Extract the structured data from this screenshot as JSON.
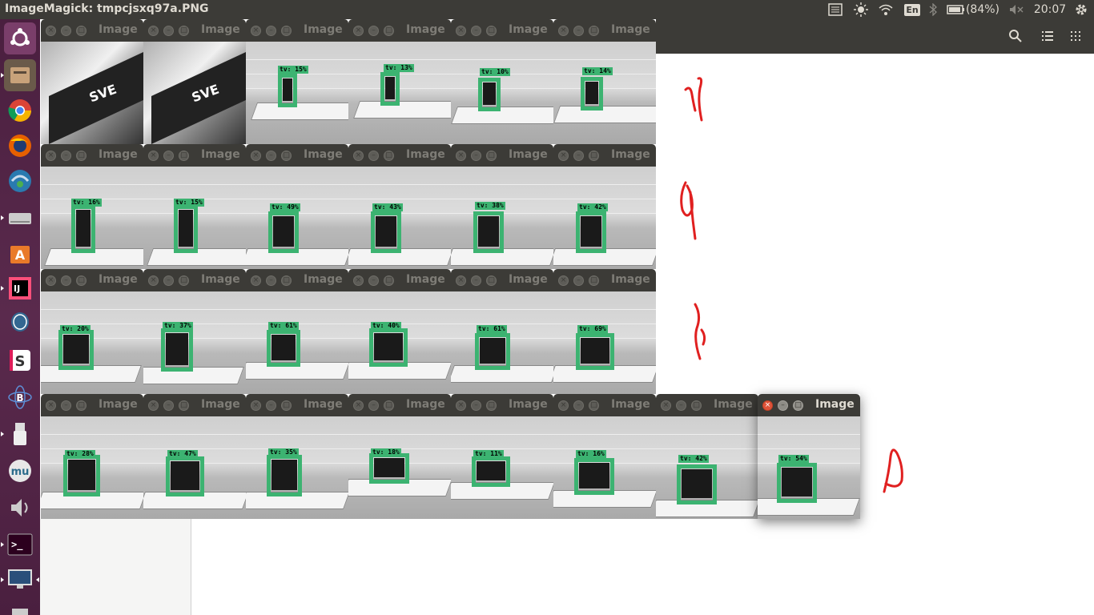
{
  "topbar": {
    "title": "ImageMagick: tmpcjsxq97a.PNG",
    "keyboard_layout": "En",
    "battery": "(84%)",
    "clock": "20:07"
  },
  "launcher": {
    "items": [
      "ubuntu-logo",
      "files",
      "chrome",
      "firefox",
      "network",
      "disks",
      "software-center",
      "intellij",
      "postgres",
      "slack",
      "atom",
      "usb",
      "mu",
      "volume",
      "terminal",
      "display",
      "trash"
    ]
  },
  "window_title": "Image",
  "windows": [
    {
      "label": ""
    },
    {
      "label": ""
    },
    {
      "label": "tv: 15%"
    },
    {
      "label": "tv: 13%"
    },
    {
      "label": "tv: 10%"
    },
    {
      "label": "tv: 14%"
    },
    {
      "label": "tv: 16%"
    },
    {
      "label": "tv: 15%"
    },
    {
      "label": "tv: 49%"
    },
    {
      "label": "tv: 43%"
    },
    {
      "label": "tv: 38%"
    },
    {
      "label": "tv: 42%"
    },
    {
      "label": "tv: 20%"
    },
    {
      "label": "tv: 37%"
    },
    {
      "label": "tv: 61%"
    },
    {
      "label": "tv: 40%"
    },
    {
      "label": "tv: 61%"
    },
    {
      "label": "tv: 69%"
    },
    {
      "label": "tv: 28%"
    },
    {
      "label": "tv: 47%"
    },
    {
      "label": "tv: 35%"
    },
    {
      "label": "tv: 18%"
    },
    {
      "label": "tv: 11%"
    },
    {
      "label": "tv: 16%"
    },
    {
      "label": "tv: 42%"
    },
    {
      "label": "tv: 54%"
    }
  ],
  "laptop_brand": "SVE"
}
